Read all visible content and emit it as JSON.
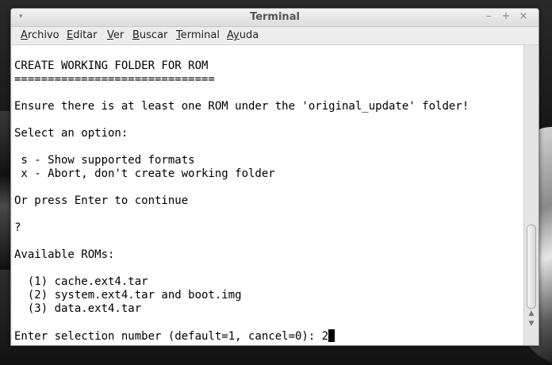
{
  "window": {
    "title": "Terminal",
    "menu_arrow": "▾",
    "controls": {
      "minimize": "–",
      "maximize": "+",
      "close": "×"
    }
  },
  "menubar": {
    "items": [
      {
        "mnemonic": "A",
        "rest": "rchivo"
      },
      {
        "mnemonic": "E",
        "rest": "ditar"
      },
      {
        "mnemonic": "V",
        "rest": "er"
      },
      {
        "mnemonic": "B",
        "rest": "uscar"
      },
      {
        "mnemonic": "T",
        "rest": "erminal"
      },
      {
        "mnemonic": "Ay",
        "rest": "uda"
      }
    ]
  },
  "terminal": {
    "lines": [
      "CREATE WORKING FOLDER FOR ROM",
      "==============================",
      "",
      "Ensure there is at least one ROM under the 'original_update' folder!",
      "",
      "Select an option:",
      "",
      " s - Show supported formats",
      " x - Abort, don't create working folder",
      "",
      "Or press Enter to continue",
      "",
      "?",
      "",
      "Available ROMs:",
      "",
      "  (1) cache.ext4.tar",
      "  (2) system.ext4.tar and boot.img",
      "  (3) data.ext4.tar",
      "",
      "Enter selection number (default=1, cancel=0): 2"
    ]
  },
  "scrollbar": {
    "up_arrow": "▲",
    "down_arrow": "▼"
  }
}
